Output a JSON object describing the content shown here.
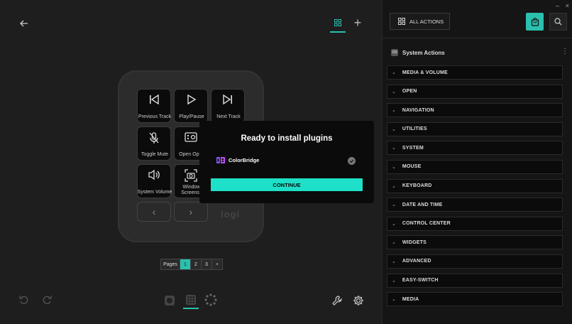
{
  "window": {
    "minimize": "–",
    "close": "×"
  },
  "toolbar": {
    "add": "+"
  },
  "device": {
    "keys": [
      {
        "label": "Previous Track",
        "icon": "previous-track-icon"
      },
      {
        "label": "Play/Pause",
        "icon": "play-icon"
      },
      {
        "label": "Next Track",
        "icon": "next-track-icon"
      },
      {
        "label": "Toggle Mute",
        "icon": "mic-mute-icon"
      },
      {
        "label": "Open Optio",
        "icon": "open-options-icon"
      },
      {
        "label": "System Volume",
        "icon": "volume-icon"
      },
      {
        "label": "Window Screensh",
        "icon": "screenshot-icon"
      }
    ],
    "nav_prev": "‹",
    "nav_next": "›",
    "logo": "logi"
  },
  "pages": {
    "label": "Pages",
    "items": [
      "1",
      "2",
      "3"
    ],
    "active": "1",
    "add": "+"
  },
  "dialog": {
    "title": "Ready to install plugins",
    "plugin_name": "ColorBridge",
    "continue_label": "CONTINUE"
  },
  "sidebar": {
    "all_actions_label": "ALL ACTIONS",
    "section_badge": "OS",
    "section_title": "System Actions",
    "categories": [
      "MEDIA & VOLUME",
      "OPEN",
      "NAVIGATION",
      "UTILITIES",
      "SYSTEM",
      "MOUSE",
      "KEYBOARD",
      "DATE AND TIME",
      "CONTROL CENTER",
      "WIDGETS",
      "ADVANCED",
      "EASY-SWITCH",
      "MEDIA"
    ]
  },
  "colors": {
    "accent": "#2bbfae",
    "continue_button": "#1ee0c8",
    "dialog_bg": "#0b0b0b"
  }
}
